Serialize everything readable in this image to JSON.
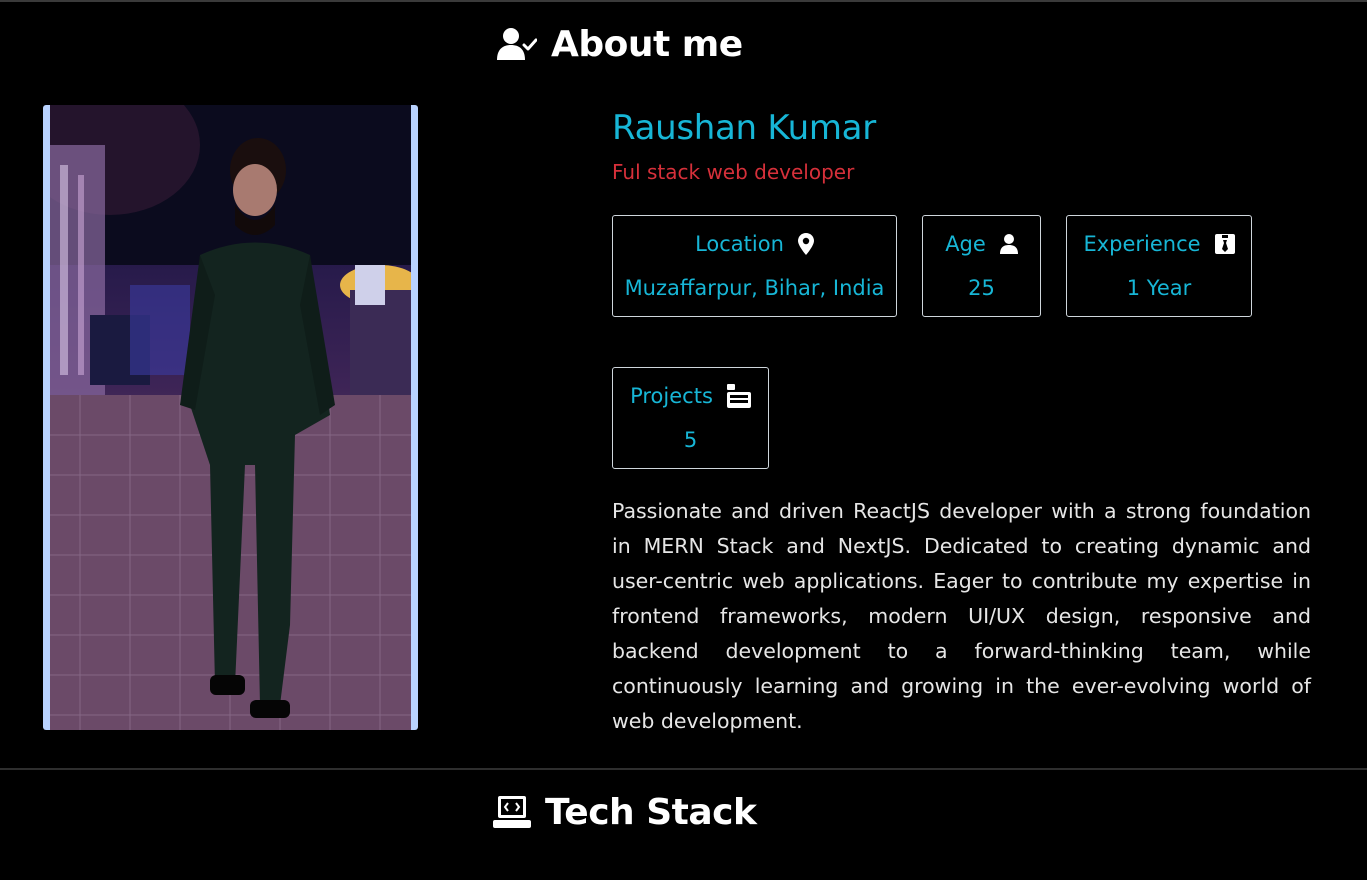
{
  "about": {
    "heading": "About me",
    "heading_icon": "user-check-icon"
  },
  "profile": {
    "name": "Raushan Kumar",
    "role": "Ful stack web developer",
    "photo_icon": "profile-photo"
  },
  "stats": {
    "location": {
      "label": "Location",
      "value": "Muzaffarpur, Bihar, India",
      "icon": "map-pin-icon"
    },
    "age": {
      "label": "Age",
      "value": "25",
      "icon": "user-icon"
    },
    "experience": {
      "label": "Experience",
      "value": "1 Year",
      "icon": "id-badge-icon"
    },
    "projects": {
      "label": "Projects",
      "value": "5",
      "icon": "project-diagram-icon"
    }
  },
  "bio": "Passionate and driven ReactJS developer with a strong foundation in MERN Stack and NextJS. Dedicated to creating dynamic and user-centric web applications. Eager to contribute my expertise in frontend frameworks, modern UI/UX design, responsive and backend development to a forward-thinking team, while continuously learning and growing in the ever-evolving world of web development.",
  "tech": {
    "heading": "Tech Stack",
    "heading_icon": "laptop-code-icon"
  },
  "colors": {
    "background": "#000000",
    "accent": "#17b6d6",
    "role": "#d6303a",
    "text": "#e6e6e6",
    "photo_border": "#b9d3ff"
  }
}
